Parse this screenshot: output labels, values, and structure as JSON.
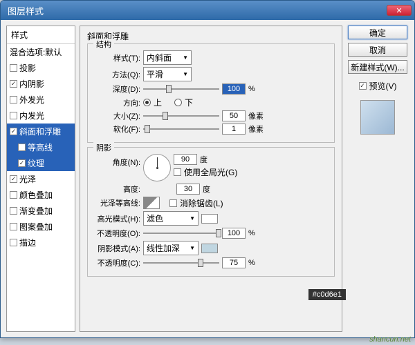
{
  "window": {
    "title": "图层样式"
  },
  "sidebar": {
    "header": "样式",
    "items": [
      {
        "label": "混合选项:默认",
        "checked": null,
        "selected": false
      },
      {
        "label": "投影",
        "checked": false,
        "selected": false
      },
      {
        "label": "内阴影",
        "checked": true,
        "selected": false
      },
      {
        "label": "外发光",
        "checked": false,
        "selected": false
      },
      {
        "label": "内发光",
        "checked": false,
        "selected": false
      },
      {
        "label": "斜面和浮雕",
        "checked": true,
        "selected": true
      },
      {
        "label": "等高线",
        "checked": false,
        "selected": true,
        "sub": true
      },
      {
        "label": "纹理",
        "checked": true,
        "selected": true,
        "sub": true
      },
      {
        "label": "光泽",
        "checked": true,
        "selected": false
      },
      {
        "label": "颜色叠加",
        "checked": false,
        "selected": false
      },
      {
        "label": "渐变叠加",
        "checked": false,
        "selected": false
      },
      {
        "label": "图案叠加",
        "checked": false,
        "selected": false
      },
      {
        "label": "描边",
        "checked": false,
        "selected": false
      }
    ]
  },
  "main": {
    "title": "斜面和浮雕",
    "structure": {
      "legend": "结构",
      "style_label": "样式(T):",
      "style_value": "内斜面",
      "method_label": "方法(Q):",
      "method_value": "平滑",
      "depth_label": "深度(D):",
      "depth_value": "100",
      "depth_unit": "%",
      "direction_label": "方向:",
      "up_label": "上",
      "down_label": "下",
      "size_label": "大小(Z):",
      "size_value": "50",
      "size_unit": "像素",
      "soften_label": "软化(F):",
      "soften_value": "1",
      "soften_unit": "像素"
    },
    "shading": {
      "legend": "阴影",
      "angle_label": "角度(N):",
      "angle_value": "90",
      "angle_unit": "度",
      "global_label": "使用全局光(G)",
      "altitude_label": "高度:",
      "altitude_value": "30",
      "altitude_unit": "度",
      "gloss_label": "光泽等高线:",
      "antialias_label": "消除锯齿(L)",
      "highlight_label": "高光模式(H):",
      "highlight_value": "滤色",
      "opacity1_label": "不透明度(O):",
      "opacity1_value": "100",
      "opacity1_unit": "%",
      "shadow_label": "阴影模式(A):",
      "shadow_value": "线性加深",
      "opacity2_label": "不透明度(C):",
      "opacity2_value": "75",
      "opacity2_unit": "%"
    }
  },
  "buttons": {
    "ok": "确定",
    "cancel": "取消",
    "new_style": "新建样式(W)...",
    "preview": "预览(V)"
  },
  "colors": {
    "highlight_swatch": "#ffffff",
    "shadow_swatch": "#c0d6e1",
    "tooltip": "#c0d6e1"
  },
  "watermark": "shancun.net"
}
